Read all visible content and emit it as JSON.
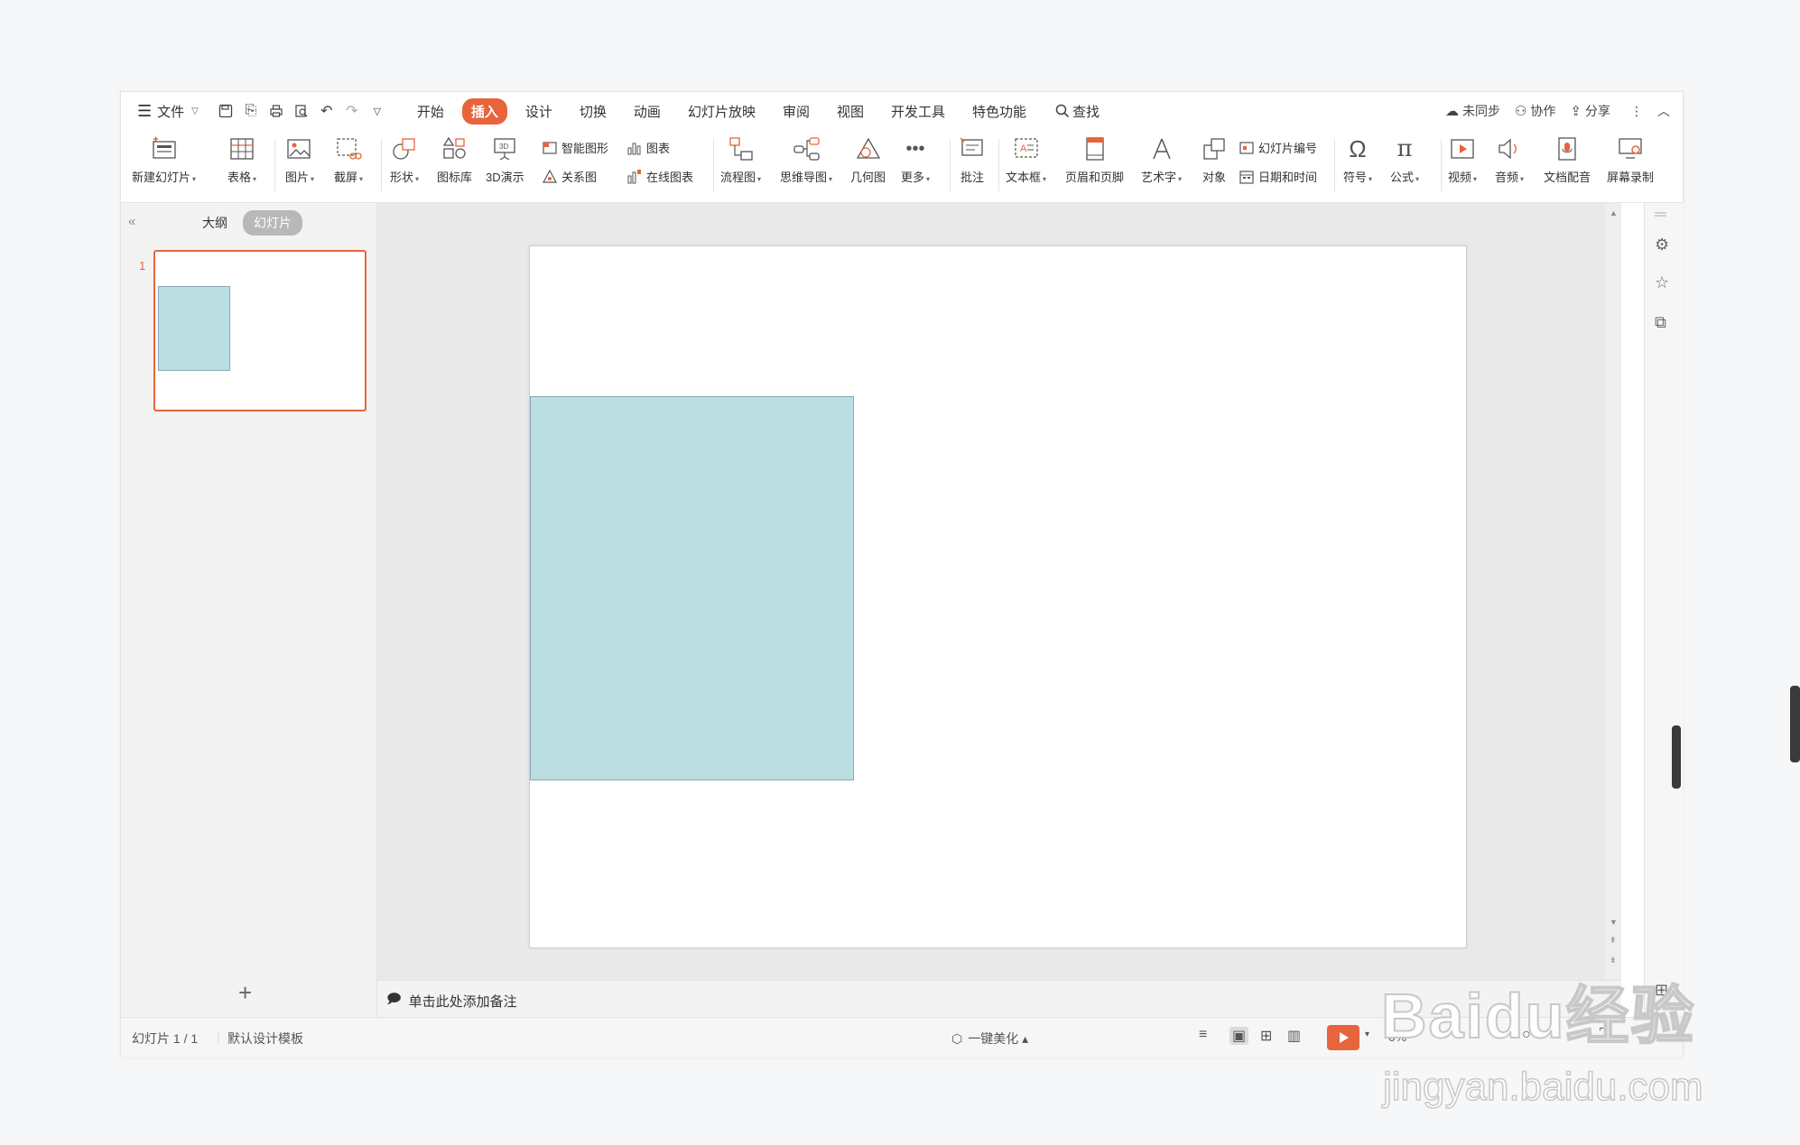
{
  "titlebar": {
    "file_menu": "文件",
    "tabs": [
      {
        "label": "开始",
        "active": false
      },
      {
        "label": "插入",
        "active": true
      },
      {
        "label": "设计",
        "active": false
      },
      {
        "label": "切换",
        "active": false
      },
      {
        "label": "动画",
        "active": false
      },
      {
        "label": "幻灯片放映",
        "active": false
      },
      {
        "label": "审阅",
        "active": false
      },
      {
        "label": "视图",
        "active": false
      },
      {
        "label": "开发工具",
        "active": false
      },
      {
        "label": "特色功能",
        "active": false
      }
    ],
    "search_label": "查找",
    "sync_label": "未同步",
    "collab_label": "协作",
    "share_label": "分享"
  },
  "ribbon": {
    "new_slide": "新建幻灯片",
    "table": "表格",
    "picture": "图片",
    "screenshot": "截屏",
    "shape": "形状",
    "icon_library": "图标库",
    "demo_3d": "3D演示",
    "smart_art": "智能图形",
    "chart": "图表",
    "relation": "关系图",
    "online_chart": "在线图表",
    "flowchart": "流程图",
    "mindmap": "思维导图",
    "geometry": "几何图",
    "more": "更多",
    "comment": "批注",
    "textbox": "文本框",
    "header_footer": "页眉和页脚",
    "word_art": "艺术字",
    "object": "对象",
    "slide_number": "幻灯片编号",
    "date_time": "日期和时间",
    "symbol": "符号",
    "formula": "公式",
    "video": "视频",
    "audio": "音频",
    "doc_dubbing": "文档配音",
    "screen_record": "屏幕录制"
  },
  "left_panel": {
    "outline_tab": "大纲",
    "slides_tab": "幻灯片",
    "slide_number": "1"
  },
  "notes": {
    "placeholder": "单击此处添加备注"
  },
  "status": {
    "slide_counter": "幻灯片 1 / 1",
    "template": "默认设计模板",
    "beautify": "一键美化",
    "zoom": "0%"
  },
  "colors": {
    "accent": "#e8643c",
    "shape_fill": "#badee1",
    "shape_border": "#8aa9b8"
  },
  "watermark": {
    "brand": "Baidu经验",
    "url": "jingyan.baidu.com"
  }
}
